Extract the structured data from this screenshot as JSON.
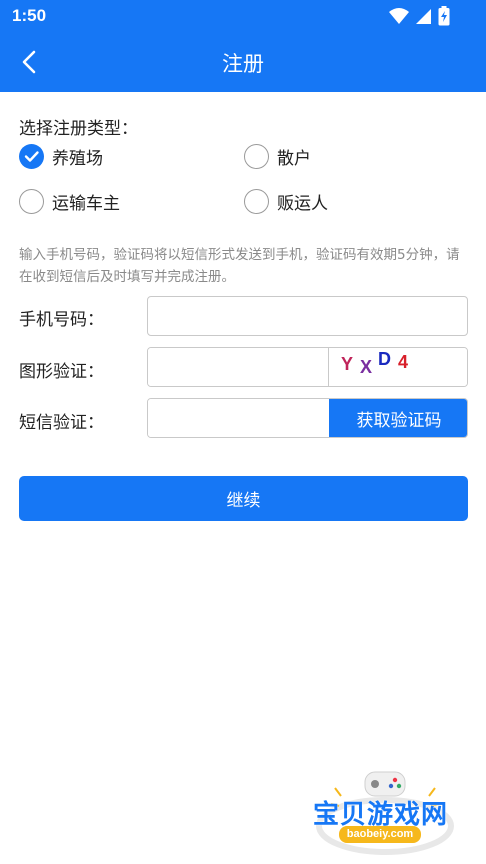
{
  "status_bar": {
    "time": "1:50"
  },
  "header": {
    "title": "注册"
  },
  "register_type": {
    "label": "选择注册类型：",
    "options": [
      {
        "label": "养殖场",
        "checked": true
      },
      {
        "label": "散户",
        "checked": false
      },
      {
        "label": "运输车主",
        "checked": false
      },
      {
        "label": "贩运人",
        "checked": false
      }
    ]
  },
  "hint": "输入手机号码，验证码将以短信形式发送到手机，验证码有效期5分钟，请在收到短信后及时填写并完成注册。",
  "form": {
    "phone_label": "手机号码：",
    "phone_value": "",
    "captcha_label": "图形验证：",
    "captcha_value": "",
    "captcha_chars": [
      "Y",
      "X",
      "D",
      "4"
    ],
    "sms_label": "短信验证：",
    "sms_value": "",
    "sms_button": "获取验证码"
  },
  "submit_label": "继续",
  "watermark": {
    "title": "宝贝游戏网",
    "url": "baobeiy.com"
  },
  "colors": {
    "primary": "#1677f5",
    "hint": "#8a8a8a"
  }
}
